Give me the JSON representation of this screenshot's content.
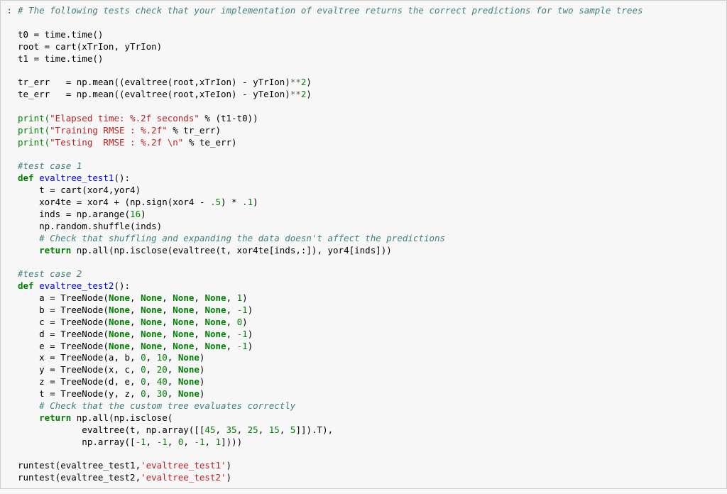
{
  "prompt_label": ":",
  "code": {
    "comment_top": "# The following tests check that your implementation of evaltree returns the correct predictions for two sample trees",
    "setup": {
      "t0": "t0 = time.time()",
      "root": "root = cart(xTrIon, yTrIon)",
      "t1": "t1 = time.time()"
    },
    "err": {
      "tr_pre": "tr_err   = np.mean((evaltree(root,xTrIon) - yTrIon)",
      "te_pre": "te_err   = np.mean((evaltree(root,xTeIon) - yTeIon)",
      "pow_op": "**",
      "pow_val": "2",
      "suffix": ")"
    },
    "prints": {
      "p1_pre": "print(",
      "p1_str": "\"Elapsed time: %.2f seconds\"",
      "p1_mid": " % (t1-t0))",
      "p2_pre": "print(",
      "p2_str": "\"Training RMSE : %.2f\"",
      "p2_mid": " % tr_err)",
      "p3_pre": "print(",
      "p3_str": "\"Testing  RMSE : %.2f \\n\"",
      "p3_mid": " % te_err)"
    },
    "test1": {
      "comment": "#test case 1",
      "def_kw": "def",
      "def_name": " evaltree_test1",
      "def_sig": "():",
      "l1": "    t = cart(xor4,yor4)",
      "l2_pre": "    xor4te = xor4 + (np.sign(xor4 - ",
      "l2_num1": ".5",
      "l2_mid": ") * ",
      "l2_num2": ".1",
      "l2_suf": ")",
      "l3_pre": "    inds = np.arange(",
      "l3_num": "16",
      "l3_suf": ")",
      "l4": "    np.random.shuffle(inds)",
      "comment2": "    # Check that shuffling and expanding the data doesn't affect the predictions",
      "ret_kw": "    return",
      "ret_body": " np.all(np.isclose(evaltree(t, xor4te[inds,:]), yor4[inds]))"
    },
    "test2": {
      "comment": "#test case 2",
      "def_kw": "def",
      "def_name": " evaltree_test2",
      "def_sig": "():",
      "node_a_pre": "    a = TreeNode(",
      "node_b_pre": "    b = TreeNode(",
      "node_c_pre": "    c = TreeNode(",
      "node_d_pre": "    d = TreeNode(",
      "node_e_pre": "    e = TreeNode(",
      "none": "None",
      "sep": ", ",
      "val_1": "1",
      "val_m1_pre": "-",
      "val_m1_num": "1",
      "val_0": "0",
      "close": ")",
      "node_x_pre": "    x = TreeNode(a, b, ",
      "node_x_v1": "0",
      "node_x_v2": "10",
      "node_y_pre": "    y = TreeNode(x, c, ",
      "node_y_v1": "0",
      "node_y_v2": "20",
      "node_z_pre": "    z = TreeNode(d, e, ",
      "node_z_v1": "0",
      "node_z_v2": "40",
      "node_t_pre": "    t = TreeNode(y, z, ",
      "node_t_v1": "0",
      "node_t_v2": "30",
      "comment2": "    # Check that the custom tree evaluates correctly",
      "ret_kw": "    return",
      "ret_l1": " np.all(np.isclose(",
      "ret_l2_pre": "            evaltree(t, np.array([[",
      "ret_l2_nums": [
        "45",
        "35",
        "25",
        "15",
        "5"
      ],
      "ret_l2_suf": "]]).T),",
      "ret_l3_pre": "            np.array([",
      "ret_l3_n1": "1",
      "ret_l3_n2": "1",
      "ret_l3_n3": "0",
      "ret_l3_n4": "1",
      "ret_l3_n5": "1",
      "ret_l3_suf": "])))"
    },
    "runtests": {
      "r1_pre": "runtest(evaltree_test1,",
      "r1_str": "'evaltree_test1'",
      "r1_suf": ")",
      "r2_pre": "runtest(evaltree_test2,",
      "r2_str": "'evaltree_test2'",
      "r2_suf": ")"
    }
  }
}
